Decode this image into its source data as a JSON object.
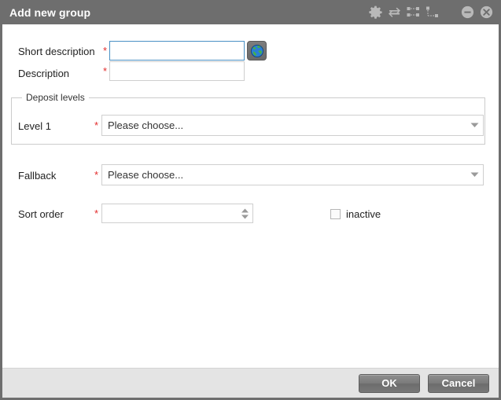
{
  "window": {
    "title": "Add new group",
    "titlebar_icons": [
      {
        "name": "settings-gear-icon",
        "label": "Settings"
      },
      {
        "name": "swap-arrows-icon",
        "label": "Swap"
      },
      {
        "name": "hierarchy-dotted-icon",
        "label": "Hierarchy"
      },
      {
        "name": "tree-connector-icon",
        "label": "Tree connector"
      }
    ],
    "minimize_label": "Minimize",
    "close_label": "Close",
    "colors": {
      "titlebar": "#6e6e6e",
      "required_asterisk": "#e32b2b",
      "focus_border": "#4a90c4",
      "footer": "#e4e4e4"
    }
  },
  "form": {
    "short_description": {
      "label": "Short description",
      "required": "*",
      "value": "",
      "placeholder": ""
    },
    "description": {
      "label": "Description",
      "required": "*",
      "value": "",
      "placeholder": ""
    },
    "globe_button": {
      "name": "translate-globe-button",
      "label": "Translations"
    },
    "deposit_levels": {
      "legend": "Deposit levels",
      "level1": {
        "label": "Level 1",
        "required": "*",
        "value": "Please choose..."
      }
    },
    "fallback": {
      "label": "Fallback",
      "required": "*",
      "value": "Please choose..."
    },
    "sort_order": {
      "label": "Sort order",
      "required": "*",
      "value": ""
    },
    "inactive": {
      "label": "inactive",
      "checked": false
    }
  },
  "footer": {
    "ok_label": "OK",
    "cancel_label": "Cancel"
  }
}
